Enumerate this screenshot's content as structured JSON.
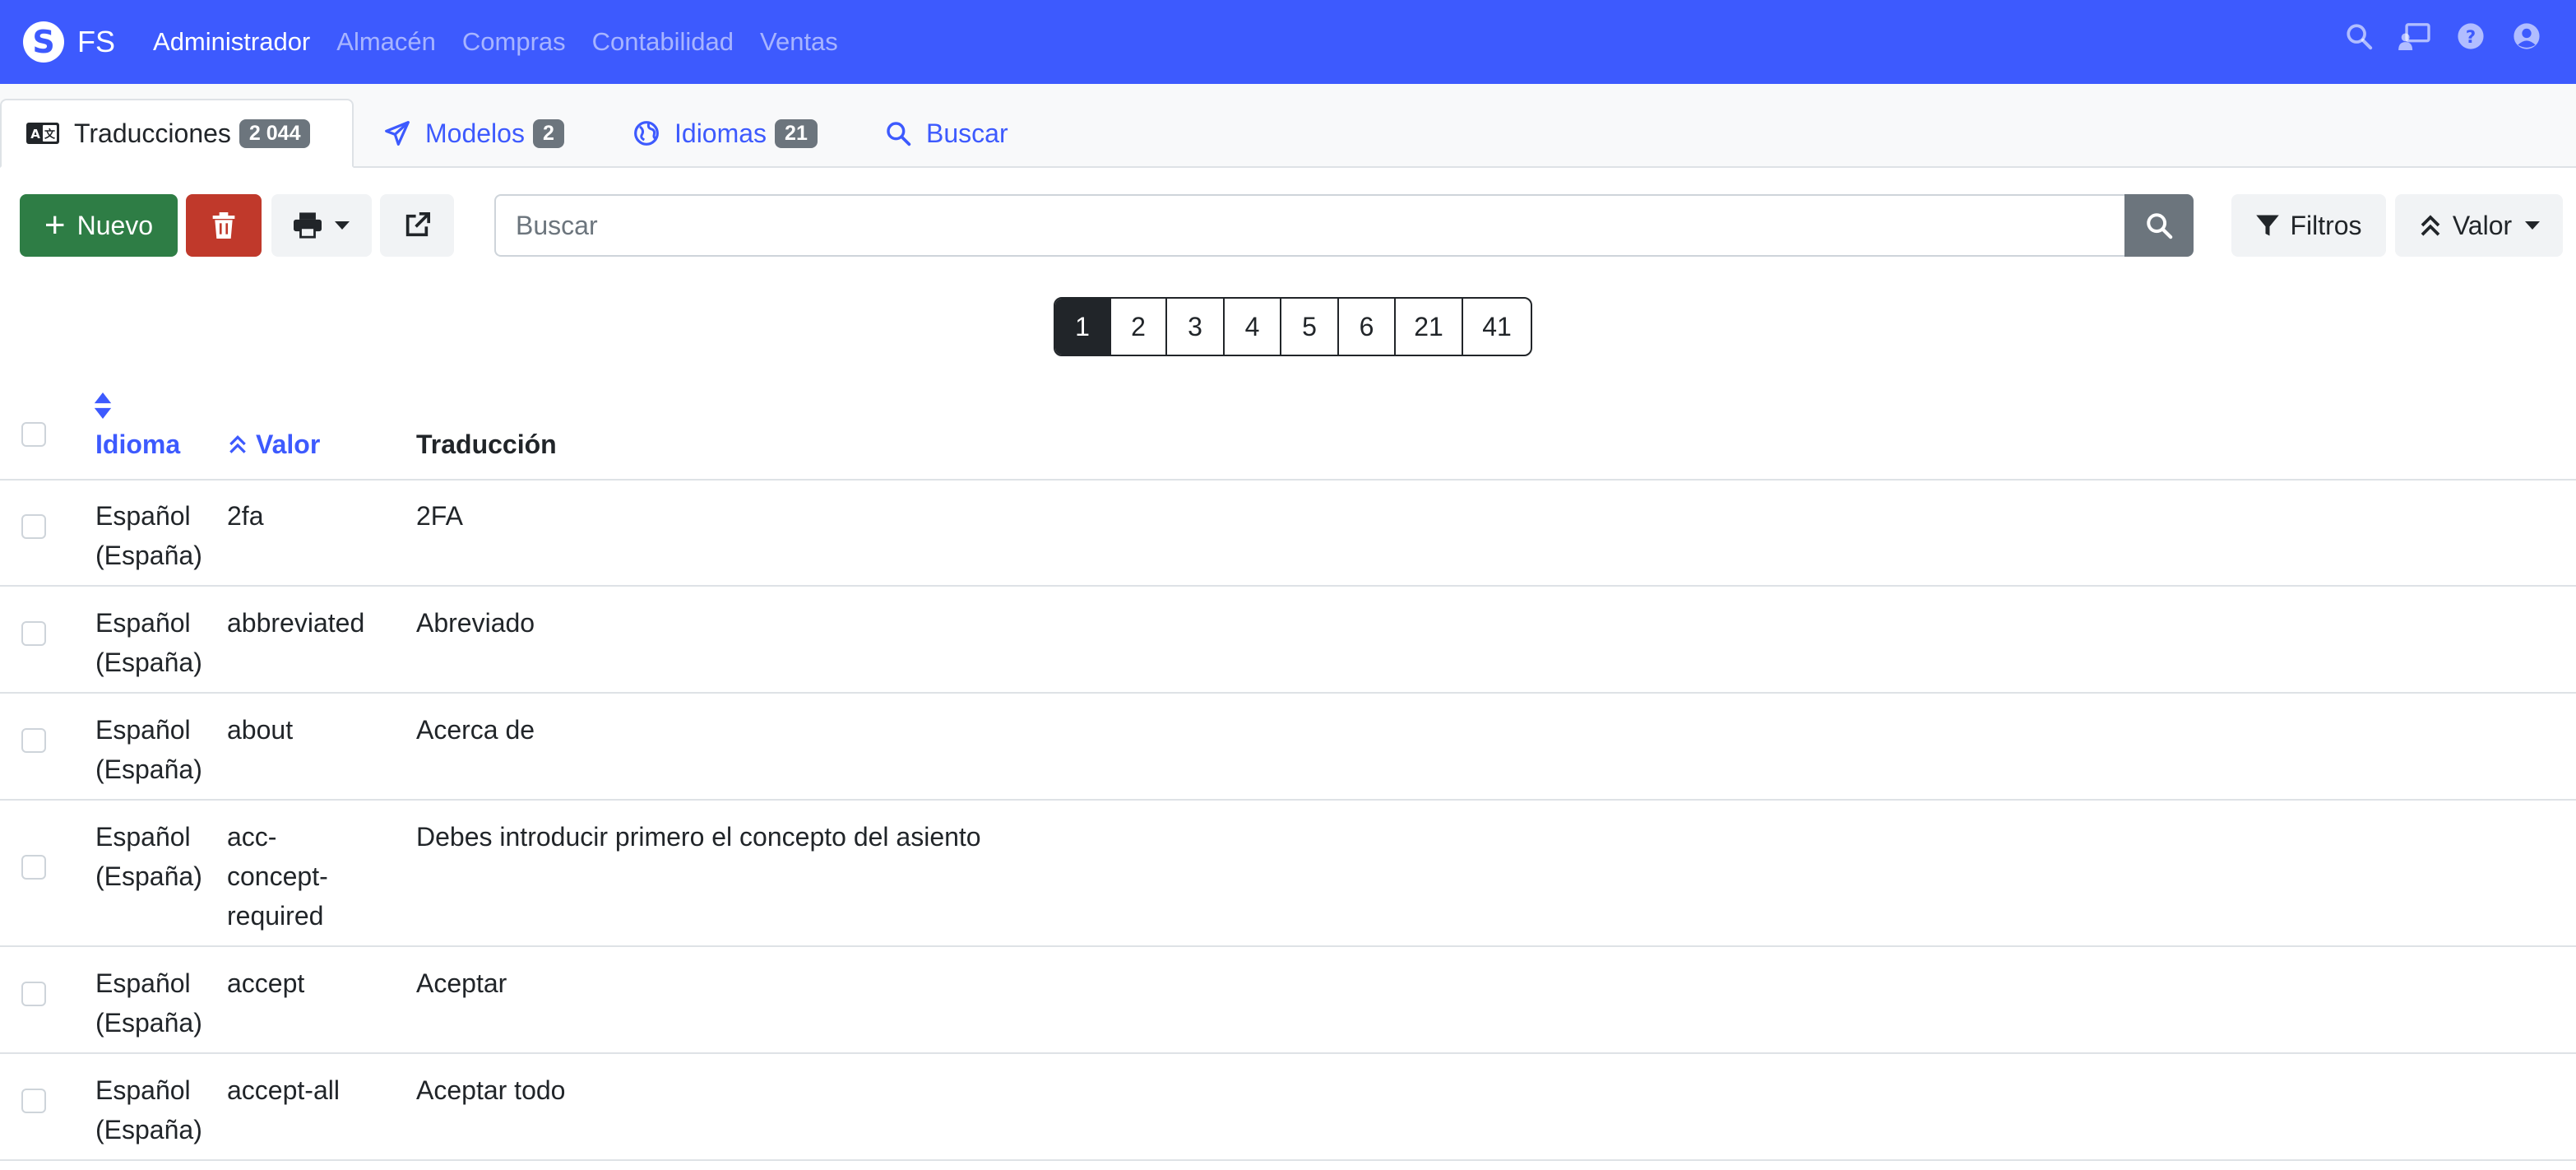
{
  "navbar": {
    "brand": "FS",
    "menu": [
      {
        "label": "Administrador",
        "active": true
      },
      {
        "label": "Almacén",
        "active": false
      },
      {
        "label": "Compras",
        "active": false
      },
      {
        "label": "Contabilidad",
        "active": false
      },
      {
        "label": "Ventas",
        "active": false
      }
    ],
    "icons": [
      "search-icon",
      "chalkboard-user-icon",
      "question-circle-icon",
      "user-circle-icon"
    ]
  },
  "tabs": [
    {
      "label": "Traducciones",
      "badge": "2 044",
      "icon": "language-icon",
      "active": true
    },
    {
      "label": "Modelos",
      "badge": "2",
      "icon": "paper-plane-icon",
      "active": false
    },
    {
      "label": "Idiomas",
      "badge": "21",
      "icon": "globe-icon",
      "active": false
    },
    {
      "label": "Buscar",
      "badge": "",
      "icon": "search-icon",
      "active": false
    }
  ],
  "toolbar": {
    "new_label": "Nuevo",
    "search_placeholder": "Buscar",
    "filters_label": "Filtros",
    "sort_label": "Valor"
  },
  "pagination": {
    "pages": [
      "1",
      "2",
      "3",
      "4",
      "5",
      "6",
      "21",
      "41"
    ],
    "current": "1"
  },
  "table": {
    "headers": {
      "language": "Idioma",
      "value": "Valor",
      "translation": "Traducción"
    },
    "rows": [
      {
        "language": "Español (España)",
        "value": "2fa",
        "translation": "2FA"
      },
      {
        "language": "Español (España)",
        "value": "abbreviated",
        "translation": "Abreviado"
      },
      {
        "language": "Español (España)",
        "value": "about",
        "translation": "Acerca de"
      },
      {
        "language": "Español (España)",
        "value": "acc-concept-required",
        "translation": "Debes introducir primero el concepto del asiento"
      },
      {
        "language": "Español (España)",
        "value": "accept",
        "translation": "Aceptar"
      },
      {
        "language": "Español (España)",
        "value": "accept-all",
        "translation": "Aceptar todo"
      }
    ]
  },
  "colors": {
    "navbar": "#3d5afe",
    "link": "#3d5afe",
    "success": "#2e7d45",
    "danger": "#c0392b",
    "badge": "#6c757d"
  }
}
